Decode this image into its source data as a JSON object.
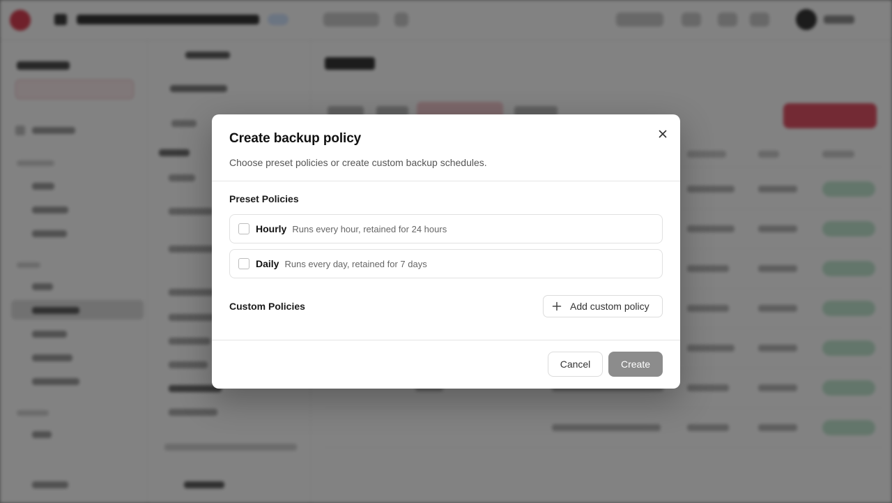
{
  "modal": {
    "title": "Create backup policy",
    "description": "Choose preset policies or create custom backup schedules.",
    "close_icon": "close-icon",
    "preset_section_label": "Preset Policies",
    "presets": [
      {
        "name": "Hourly",
        "description": "Runs every hour, retained for 24 hours",
        "checked": false
      },
      {
        "name": "Daily",
        "description": "Runs every day, retained for 7 days",
        "checked": false
      }
    ],
    "custom_section_label": "Custom Policies",
    "add_custom_label": "Add custom policy",
    "add_custom_icon": "plus-icon",
    "cancel_label": "Cancel",
    "create_label": "Create",
    "create_disabled": true
  },
  "colors": {
    "overlay": "#000000",
    "accent": "#d9364a",
    "create_button_disabled": "#8c8c8c",
    "status_success": "#bfe6cf"
  }
}
